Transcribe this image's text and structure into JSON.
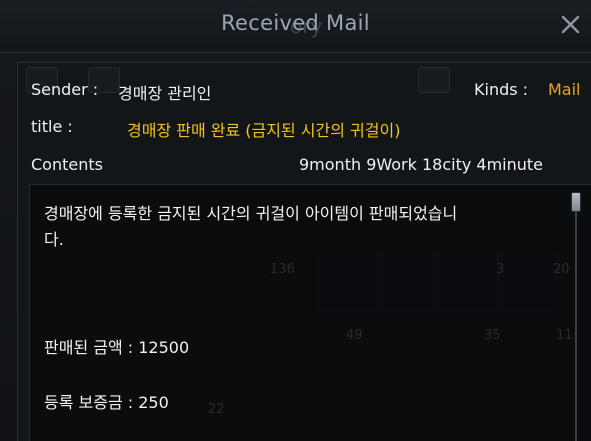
{
  "window": {
    "title": "Received Mail",
    "background_title_fragment": "ory"
  },
  "header": {
    "sender_label": "Sender :",
    "sender_value": "경매장 관리인",
    "kinds_label": "Kinds :",
    "kinds_value": "Mail",
    "title_label": "title :",
    "title_value": "경매장 판매 완료 (금지된 시간의 귀걸이)",
    "contents_label": "Contents",
    "timestamp": "9month 9Work 18city 4minute"
  },
  "body": {
    "line1": "경매장에 등록한 금지된 시간의 귀걸이 아이템이 판매되었습니",
    "line2": "다.",
    "sale_amount": "판매된 금액 : 12500",
    "deposit": "등록 보증금 : 250"
  },
  "background_numbers": [
    "136",
    "3",
    "20",
    "35",
    "22",
    "11",
    "49"
  ],
  "colors": {
    "title_text": "#9aa7b3",
    "kinds_value": "#f0a21c",
    "mail_title": "#f2c21a",
    "text": "#f0f0f0"
  },
  "icons": {
    "close": "close-icon"
  }
}
